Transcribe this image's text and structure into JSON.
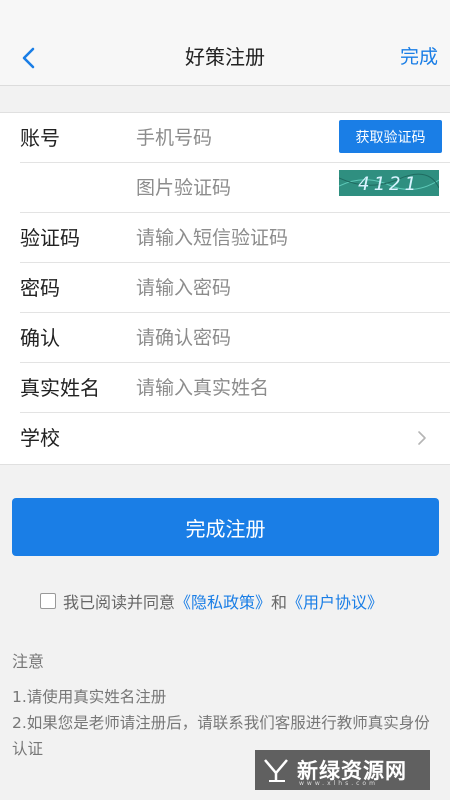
{
  "header": {
    "title": "好策注册",
    "done_label": "完成"
  },
  "form": {
    "account": {
      "label": "账号",
      "placeholder": "手机号码",
      "get_code_label": "获取验证码"
    },
    "image_code": {
      "placeholder": "图片验证码",
      "captcha_text": "4121"
    },
    "sms_code": {
      "label": "验证码",
      "placeholder": "请输入短信验证码"
    },
    "password": {
      "label": "密码",
      "placeholder": "请输入密码"
    },
    "confirm": {
      "label": "确认",
      "placeholder": "请确认密码"
    },
    "real_name": {
      "label": "真实姓名",
      "placeholder": "请输入真实姓名"
    },
    "school": {
      "label": "学校"
    }
  },
  "submit_label": "完成注册",
  "agreement": {
    "prefix": "我已阅读并同意",
    "privacy_link": "《隐私政策》",
    "and": "和",
    "terms_link": "《用户协议》",
    "checked": false
  },
  "notice": {
    "title": "注意",
    "line1": "1.请使用真实姓名注册",
    "line2": "2.如果您是老师请注册后，请联系我们客服进行教师真实身份认证"
  },
  "watermark": {
    "text": "新绿资源网",
    "sub": "www.xlhs.com"
  },
  "colors": {
    "accent": "#1a7ee6",
    "background": "#f2f2f2"
  }
}
